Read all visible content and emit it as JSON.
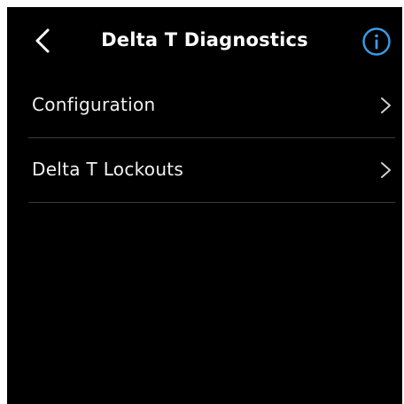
{
  "header": {
    "title": "Delta T Diagnostics",
    "back_icon": "chevron-left-icon",
    "info_icon": "info-icon"
  },
  "menu": {
    "items": [
      {
        "label": "Configuration",
        "icon": "chevron-right-icon"
      },
      {
        "label": "Delta T Lockouts",
        "icon": "chevron-right-icon"
      }
    ]
  },
  "colors": {
    "background": "#000000",
    "text": "#ffffff",
    "accent": "#3a9be8",
    "divider": "#3a3a3a"
  }
}
